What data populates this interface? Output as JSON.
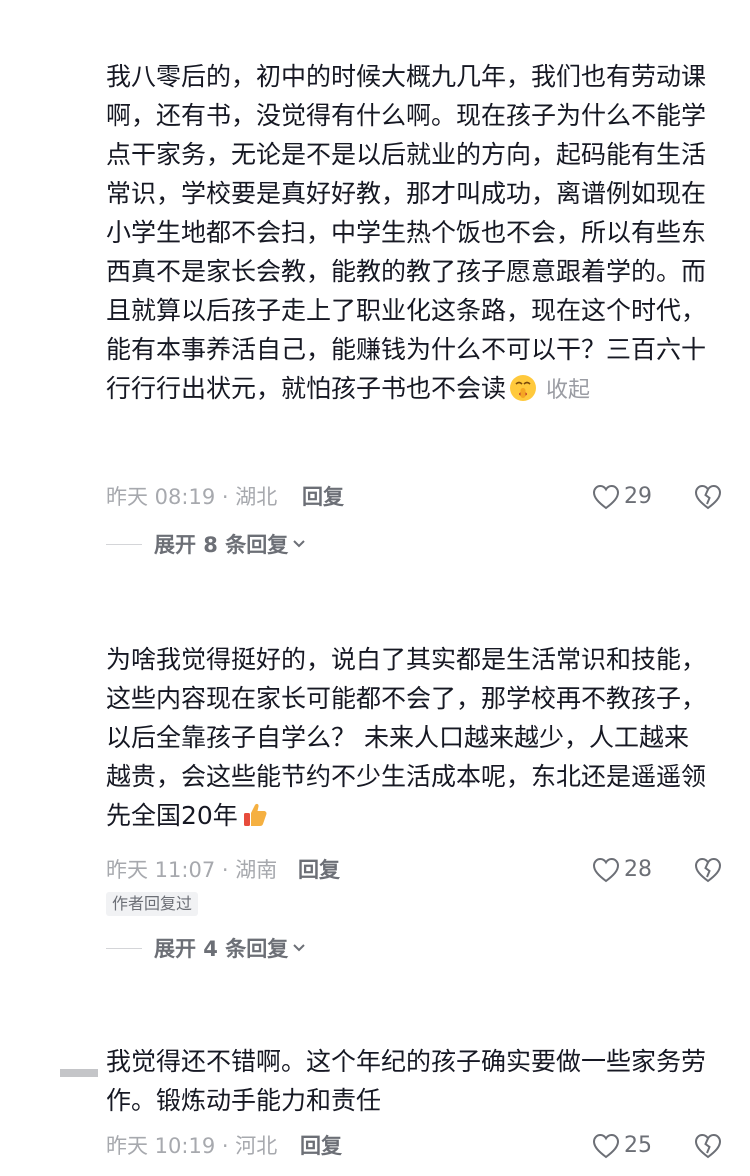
{
  "comments": [
    {
      "text_before_emoji": "我八零后的，初中的时候大概九几年，我们也有劳动课啊，还有书，没觉得有什么啊。现在孩子为什么不能学点干家务，无论是不是以后就业的方向，起码能有生活常识，学校要是真好好教，那才叫成功，离谱例如现在小学生地都不会扫，中学生热个饭也不会，所以有些东西真不是家长会教，能教的教了孩子愿意跟着学的。而且就算以后孩子走上了职业化这条路，现在这个时代，能有本事养活自己，能赚钱为什么不可以干？三百六十行行行出状元，就怕孩子书也不会读",
      "emoji": "shushing-face-emoji",
      "collapse_label": "收起",
      "time_location": "昨天 08:19 · 湖北",
      "reply_label": "回复",
      "like_count": "29",
      "expand_label": "展开 8 条回复"
    },
    {
      "text_before_emoji": "为啥我觉得挺好的，说白了其实都是生活常识和技能，这些内容现在家长可能都不会了，那学校再不教孩子，以后全靠孩子自学么？ 未来人口越来越少，人工越来越贵，会这些能节约不少生活成本呢，东北还是遥遥领先全国20年",
      "emoji": "thumbs-up-emoji",
      "time_location": "昨天 11:07 · 湖南",
      "reply_label": "回复",
      "like_count": "28",
      "author_badge": "作者回复过",
      "expand_label": "展开 4 条回复"
    },
    {
      "text_before_emoji": "我觉得还不错啊。这个年纪的孩子确实要做一些家务劳作。锻炼动手能力和责任",
      "time_location": "昨天 10:19 · 河北",
      "reply_label": "回复",
      "like_count": "25"
    }
  ],
  "colors": {
    "text": "#161823",
    "meta": "#a7a9ae",
    "action": "#6c6f76"
  }
}
